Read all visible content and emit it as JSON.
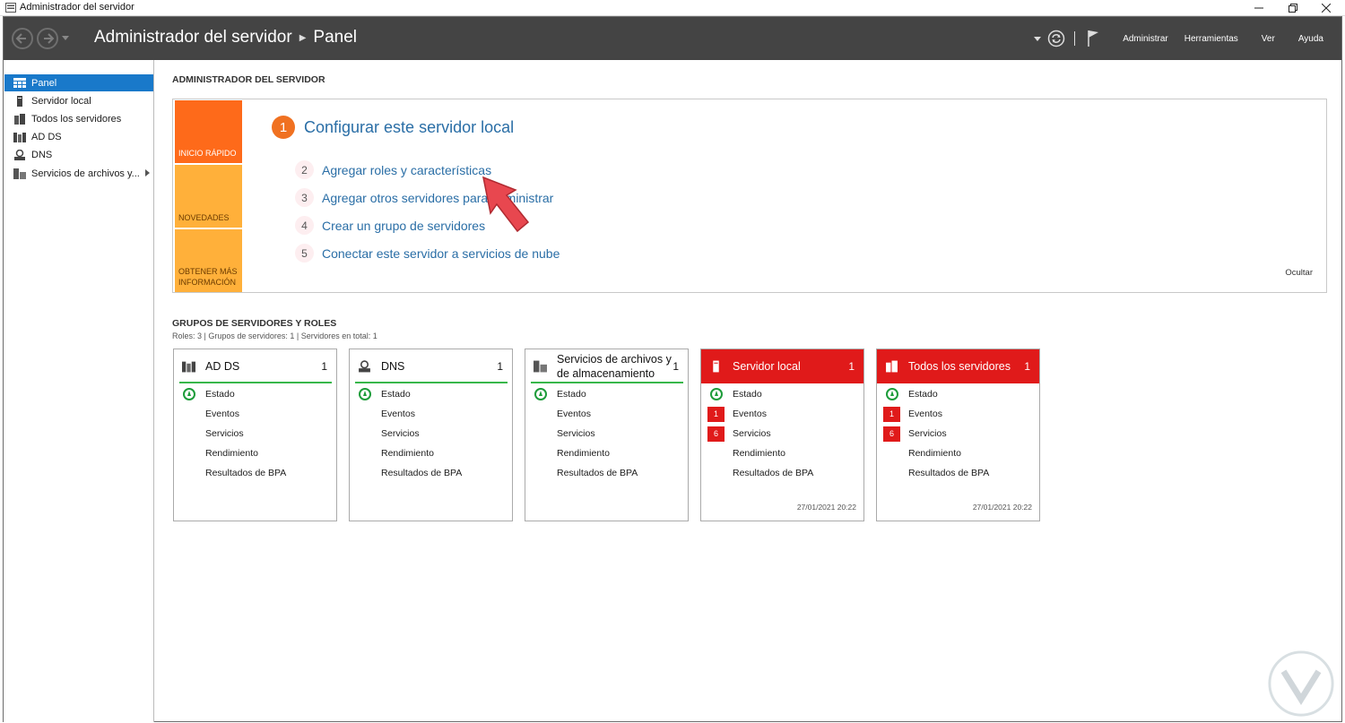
{
  "window": {
    "title": "Administrador del servidor"
  },
  "header": {
    "breadcrumb": [
      "Administrador del servidor",
      "Panel"
    ],
    "menus": [
      "Administrar",
      "Herramientas",
      "Ver",
      "Ayuda"
    ]
  },
  "sidebar": {
    "items": [
      {
        "label": "Panel",
        "icon": "dashboard-icon",
        "active": true
      },
      {
        "label": "Servidor local",
        "icon": "server-icon"
      },
      {
        "label": "Todos los servidores",
        "icon": "servers-icon"
      },
      {
        "label": "AD DS",
        "icon": "ad-ds-icon"
      },
      {
        "label": "DNS",
        "icon": "dns-icon"
      },
      {
        "label": "Servicios de archivos y...",
        "icon": "file-services-icon",
        "has_children": true
      }
    ]
  },
  "welcome": {
    "section_title": "ADMINISTRADOR DEL SERVIDOR",
    "tiles": [
      {
        "label": "INICIO RÁPIDO",
        "color": "#fe6a1a"
      },
      {
        "label": "NOVEDADES",
        "color": "#ffb03a"
      },
      {
        "label": "OBTENER MÁS INFORMACIÓN",
        "color": "#ffb03a"
      }
    ],
    "main_step": {
      "num": "1",
      "label": "Configurar este servidor local"
    },
    "steps": [
      {
        "num": "2",
        "label": "Agregar roles y características"
      },
      {
        "num": "3",
        "label": "Agregar otros servidores para administrar"
      },
      {
        "num": "4",
        "label": "Crear un grupo de servidores"
      },
      {
        "num": "5",
        "label": "Conectar este servidor a servicios de nube"
      }
    ],
    "hide": "Ocultar"
  },
  "groups": {
    "section_title": "GRUPOS DE SERVIDORES Y ROLES",
    "summary": "Roles: 3   |   Grupos de servidores: 1   |   Servidores en total: 1",
    "cards": [
      {
        "title": "AD DS",
        "count": "1",
        "style": "green",
        "icon": "ad-ds-icon",
        "rows": [
          {
            "label": "Estado",
            "ok": true
          },
          {
            "label": "Eventos"
          },
          {
            "label": "Servicios"
          },
          {
            "label": "Rendimiento"
          },
          {
            "label": "Resultados de BPA"
          }
        ],
        "stamp": ""
      },
      {
        "title": "DNS",
        "count": "1",
        "style": "green",
        "icon": "dns-icon",
        "rows": [
          {
            "label": "Estado",
            "ok": true
          },
          {
            "label": "Eventos"
          },
          {
            "label": "Servicios"
          },
          {
            "label": "Rendimiento"
          },
          {
            "label": "Resultados de BPA"
          }
        ],
        "stamp": ""
      },
      {
        "title": "Servicios de archivos y de almacenamiento",
        "count": "1",
        "style": "green",
        "icon": "file-services-icon",
        "rows": [
          {
            "label": "Estado",
            "ok": true
          },
          {
            "label": "Eventos"
          },
          {
            "label": "Servicios"
          },
          {
            "label": "Rendimiento"
          },
          {
            "label": "Resultados de BPA"
          }
        ],
        "stamp": ""
      },
      {
        "title": "Servidor local",
        "count": "1",
        "style": "red",
        "icon": "server-icon",
        "rows": [
          {
            "label": "Estado",
            "ok": true
          },
          {
            "label": "Eventos",
            "badge": "1"
          },
          {
            "label": "Servicios",
            "badge": "6"
          },
          {
            "label": "Rendimiento"
          },
          {
            "label": "Resultados de BPA"
          }
        ],
        "stamp": "27/01/2021 20:22"
      },
      {
        "title": "Todos los servidores",
        "count": "1",
        "style": "red",
        "icon": "servers-icon",
        "rows": [
          {
            "label": "Estado",
            "ok": true
          },
          {
            "label": "Eventos",
            "badge": "1"
          },
          {
            "label": "Servicios",
            "badge": "6"
          },
          {
            "label": "Rendimiento"
          },
          {
            "label": "Resultados de BPA"
          }
        ],
        "stamp": "27/01/2021 20:22"
      }
    ]
  }
}
